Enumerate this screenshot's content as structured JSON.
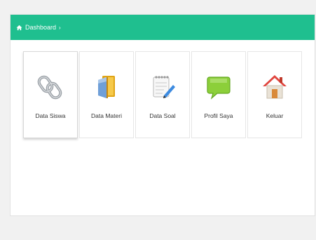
{
  "breadcrumb": {
    "label": "Dashboard",
    "separator": "›"
  },
  "colors": {
    "header": "#1fbf8f",
    "panel": "#ffffff",
    "page": "#f1f1f1"
  },
  "tiles": [
    {
      "label": "Data Siswa",
      "icon": "link-chain-icon"
    },
    {
      "label": "Data Materi",
      "icon": "book-folder-icon"
    },
    {
      "label": "Data Soal",
      "icon": "notepad-pencil-icon"
    },
    {
      "label": "Profil Saya",
      "icon": "speech-bubble-icon"
    },
    {
      "label": "Keluar",
      "icon": "home-exit-icon"
    }
  ]
}
